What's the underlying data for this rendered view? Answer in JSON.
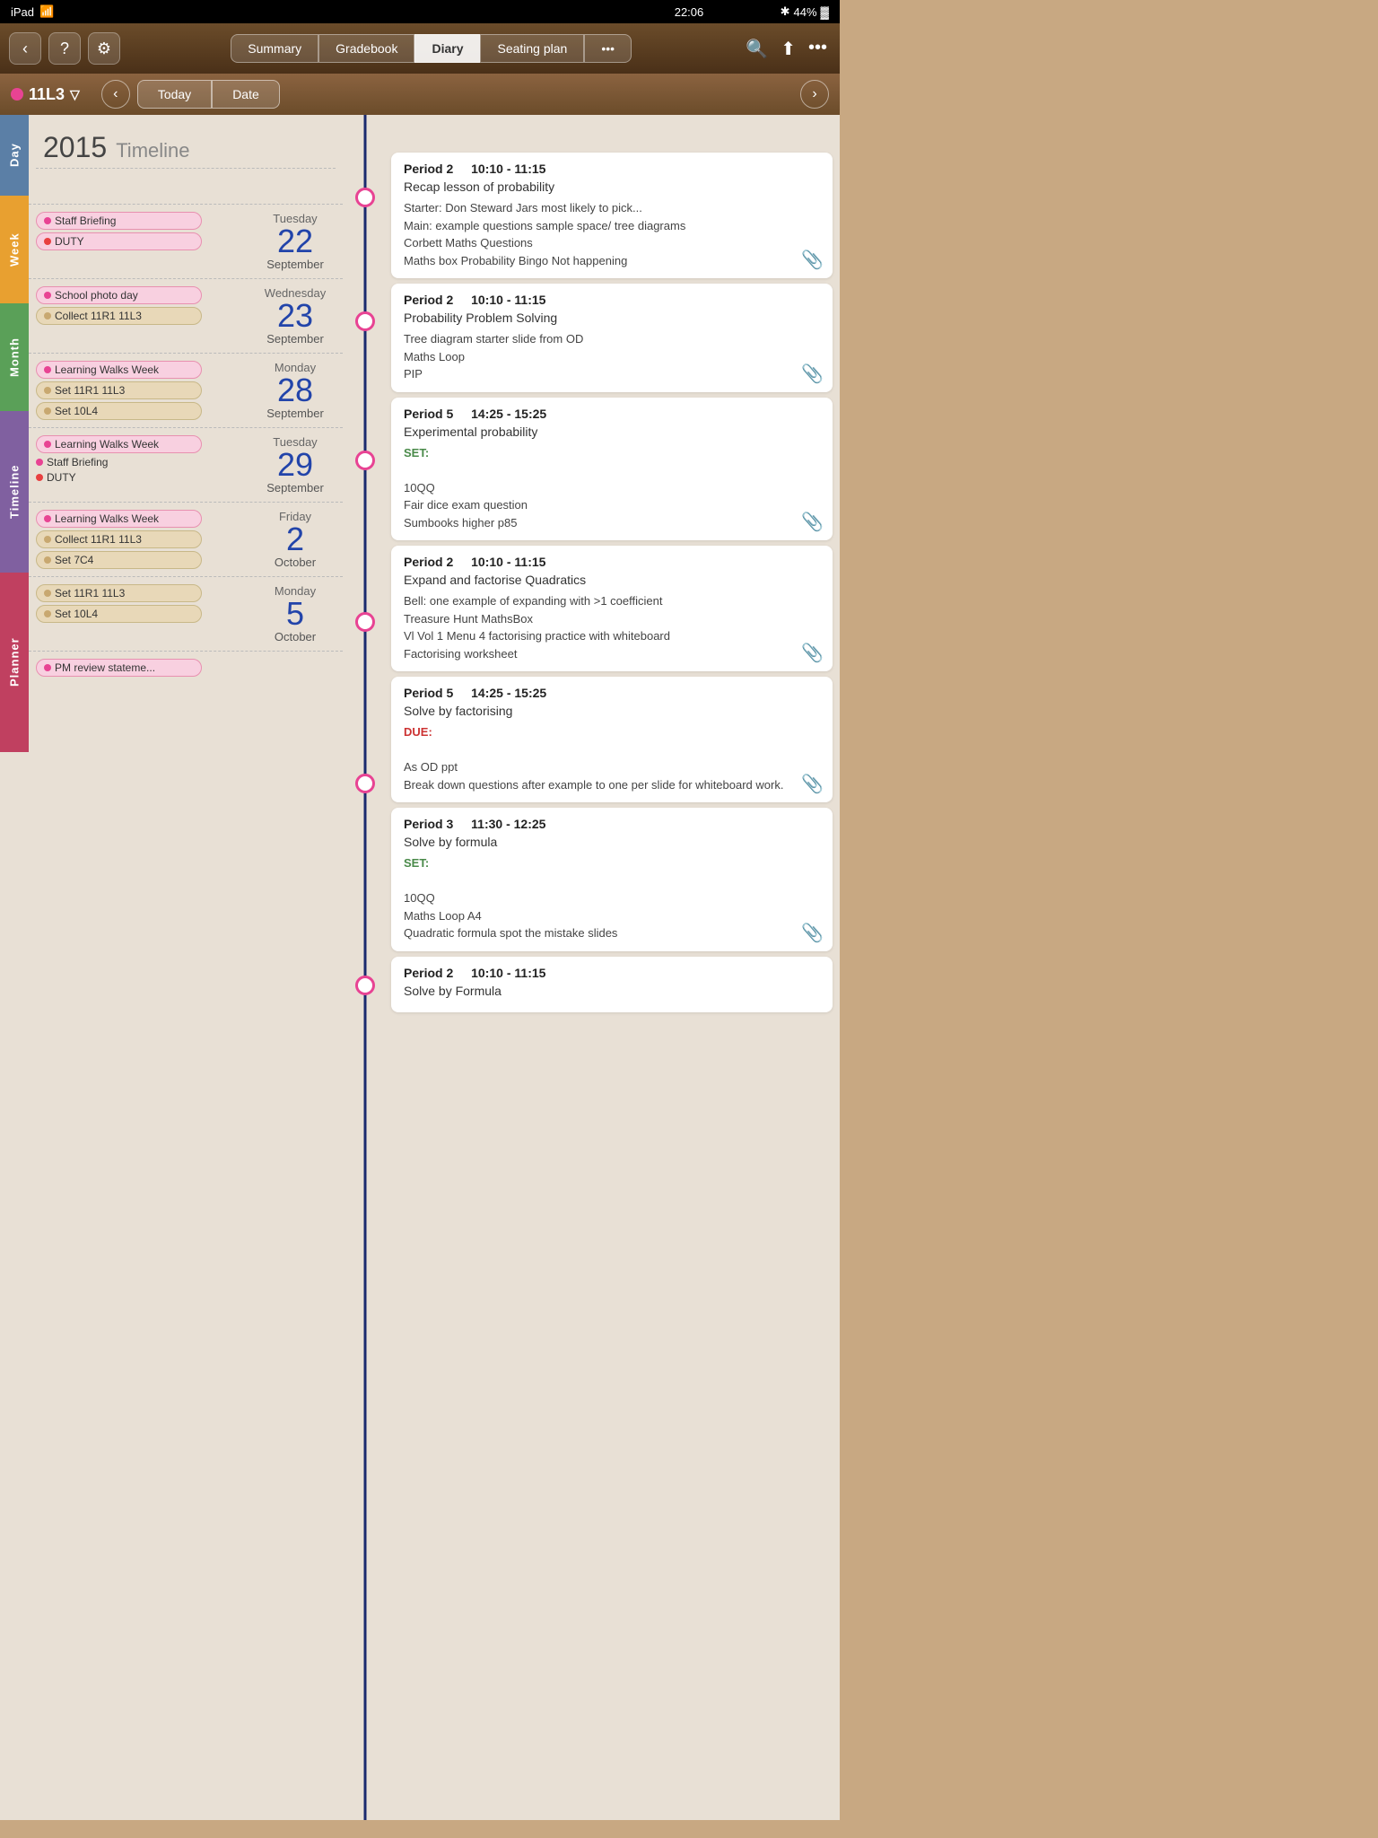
{
  "statusBar": {
    "left": "iPad",
    "wifi": "wifi",
    "time": "22:06",
    "bluetooth": "bluetooth",
    "battery": "44%"
  },
  "topNav": {
    "backLabel": "‹",
    "helpLabel": "?",
    "settingsLabel": "⚙",
    "tabs": [
      {
        "id": "summary",
        "label": "Summary"
      },
      {
        "id": "gradebook",
        "label": "Gradebook"
      },
      {
        "id": "diary",
        "label": "Diary",
        "active": true
      },
      {
        "id": "seating",
        "label": "Seating plan"
      },
      {
        "id": "more",
        "label": "•••"
      }
    ],
    "searchLabel": "🔍",
    "shareLabel": "⬆",
    "moreLabel": "•••"
  },
  "subNav": {
    "className": "11L3",
    "filterIcon": "▽",
    "prevLabel": "‹",
    "todayLabel": "Today",
    "dateLabel": "Date",
    "nextLabel": "›"
  },
  "yearTitle": "2015",
  "timelineLabel": "Timeline",
  "sideTabs": [
    {
      "id": "day",
      "label": "Day"
    },
    {
      "id": "week",
      "label": "Week"
    },
    {
      "id": "month",
      "label": "Month"
    },
    {
      "id": "timeline",
      "label": "Timeline"
    },
    {
      "id": "planner",
      "label": "Planner"
    }
  ],
  "days": [
    {
      "id": "tue22sep",
      "dayName": "Tuesday",
      "dayNum": "22",
      "month": "September",
      "events": [
        {
          "label": "Staff Briefing",
          "type": "pink",
          "dot": "pink"
        },
        {
          "label": "DUTY",
          "type": "pink",
          "dot": "red"
        }
      ]
    },
    {
      "id": "wed23sep",
      "dayName": "Wednesday",
      "dayNum": "23",
      "month": "September",
      "events": [
        {
          "label": "School photo day",
          "type": "pink",
          "dot": "pink"
        },
        {
          "label": "Collect 11R1 11L3",
          "type": "tan",
          "dot": "tan"
        }
      ]
    },
    {
      "id": "mon28sep",
      "dayName": "Monday",
      "dayNum": "28",
      "month": "September",
      "events": [
        {
          "label": "Learning Walks Week",
          "type": "pink",
          "dot": "pink"
        },
        {
          "label": "Set 11R1 11L3",
          "type": "tan",
          "dot": "tan"
        },
        {
          "label": "Set 10L4",
          "type": "tan",
          "dot": "tan"
        }
      ]
    },
    {
      "id": "tue29sep",
      "dayName": "Tuesday",
      "dayNum": "29",
      "month": "September",
      "events": [
        {
          "label": "Learning Walks Week",
          "type": "pink",
          "dot": "pink"
        },
        {
          "label": "Staff Briefing",
          "type": "",
          "dot": "pink"
        },
        {
          "label": "DUTY",
          "type": "",
          "dot": "red"
        }
      ]
    },
    {
      "id": "fri2oct",
      "dayName": "Friday",
      "dayNum": "2",
      "month": "October",
      "events": [
        {
          "label": "Learning Walks Week",
          "type": "pink",
          "dot": "pink"
        },
        {
          "label": "Collect 11R1 11L3",
          "type": "tan",
          "dot": "tan"
        },
        {
          "label": "Set 7C4",
          "type": "tan",
          "dot": "tan"
        }
      ]
    },
    {
      "id": "mon5oct",
      "dayName": "Monday",
      "dayNum": "5",
      "month": "October",
      "events": [
        {
          "label": "Set 11R1 11L3",
          "type": "tan",
          "dot": "tan"
        },
        {
          "label": "Set 10L4",
          "type": "tan",
          "dot": "tan"
        }
      ]
    },
    {
      "id": "tue6oct",
      "dayName": "",
      "dayNum": "",
      "month": "",
      "events": [
        {
          "label": "PM review stateme...",
          "type": "pink",
          "dot": "pink"
        }
      ]
    }
  ],
  "lessons": [
    {
      "id": "l1",
      "period": "Period 2",
      "time": "10:10 - 11:15",
      "title": "Recap lesson of probability",
      "body": "Starter: Don Steward Jars most likely to pick...\nMain: example questions sample space/ tree diagrams\nCorbett Maths Questions\nMaths box Probability Bingo Not happening",
      "hasClip": true
    },
    {
      "id": "l2",
      "period": "Period 2",
      "time": "10:10 - 11:15",
      "title": "Probability Problem Solving",
      "body": "Tree diagram starter slide from OD\nMaths Loop\nPIP",
      "hasClip": true
    },
    {
      "id": "l3",
      "period": "Period 5",
      "time": "14:25 - 15:25",
      "title": "Experimental probability",
      "set": "SET:",
      "body": "10QQ\nFair dice exam question\nSumbooks higher p85",
      "hasClip": true
    },
    {
      "id": "l4",
      "period": "Period 2",
      "time": "10:10 - 11:15",
      "title": "Expand and factorise Quadratics",
      "body": "Bell: one example of expanding with >1 coefficient\nTreasure Hunt MathsBox\nVl Vol 1 Menu 4 factorising practice with whiteboard\nFactorising worksheet",
      "hasClip": true
    },
    {
      "id": "l5",
      "period": "Period 5",
      "time": "14:25 - 15:25",
      "title": "Solve by factorising",
      "due": "DUE:",
      "body": "As OD ppt\nBreak down questions after example to one per slide for whiteboard work.",
      "hasClip": true
    },
    {
      "id": "l6",
      "period": "Period 3",
      "time": "11:30 - 12:25",
      "title": "Solve by formula",
      "set": "SET:",
      "body": "10QQ\nMaths Loop A4\nQuadratic formula spot the mistake slides",
      "hasClip": true
    },
    {
      "id": "l7",
      "period": "Period 2",
      "time": "10:10 - 11:15",
      "title": "Solve by Formula",
      "hasClip": false
    }
  ]
}
